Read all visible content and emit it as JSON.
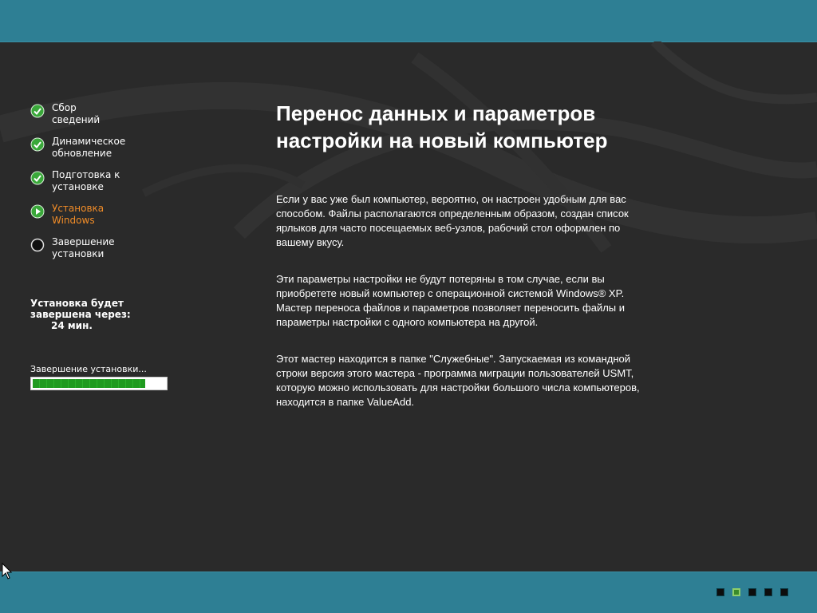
{
  "steps": [
    {
      "label": "Сбор\nсведений",
      "status": "done",
      "icon": "check-icon"
    },
    {
      "label": "Динамическое\nобновление",
      "status": "done",
      "icon": "check-icon"
    },
    {
      "label": "Подготовка к\nустановке",
      "status": "done",
      "icon": "check-icon"
    },
    {
      "label": "Установка\nWindows",
      "status": "current",
      "icon": "play-arrow-icon"
    },
    {
      "label": "Завершение\nустановки",
      "status": "pending",
      "icon": "circle-icon"
    }
  ],
  "eta": {
    "label": "Установка будет завершена через:",
    "time": "24 мин."
  },
  "progress": {
    "label": "Завершение установки...",
    "value": 0.85
  },
  "main": {
    "title": "Перенос данных и параметров\nнастройки на новый компьютер",
    "paragraphs": [
      "Если у вас уже был компьютер, вероятно, он настроен удобным для вас\nспособом. Файлы располагаются определенным образом, создан список\nярлыков для часто посещаемых веб-узлов, рабочий стол оформлен по\nвашему вкусу.",
      "Эти параметры настройки не будут потеряны в том случае, если вы\nприобретете новый компьютер с операционной системой Windows® XP.\nМастер переноса файлов и параметров позволяет переносить файлы и\nпараметры настройки с одного компьютера на другой.",
      "Этот мастер находится в папке \"Служебные\". Запускаемая из командной\nстроки версия этого мастера - программа миграции пользователей USMT,\nкоторую можно использовать для настройки большого числа компьютеров,\nнаходится в папке ValueAdd."
    ]
  },
  "slide_indicators": [
    {
      "state": "inactive"
    },
    {
      "state": "active"
    },
    {
      "state": "inactive"
    },
    {
      "state": "inactive"
    },
    {
      "state": "inactive"
    }
  ],
  "colors": {
    "bar": "#2e7f94",
    "background": "#2a2a2a",
    "current_step": "#f08c28",
    "check_green": "#3aa83a",
    "progress": "#1f9a1f"
  }
}
